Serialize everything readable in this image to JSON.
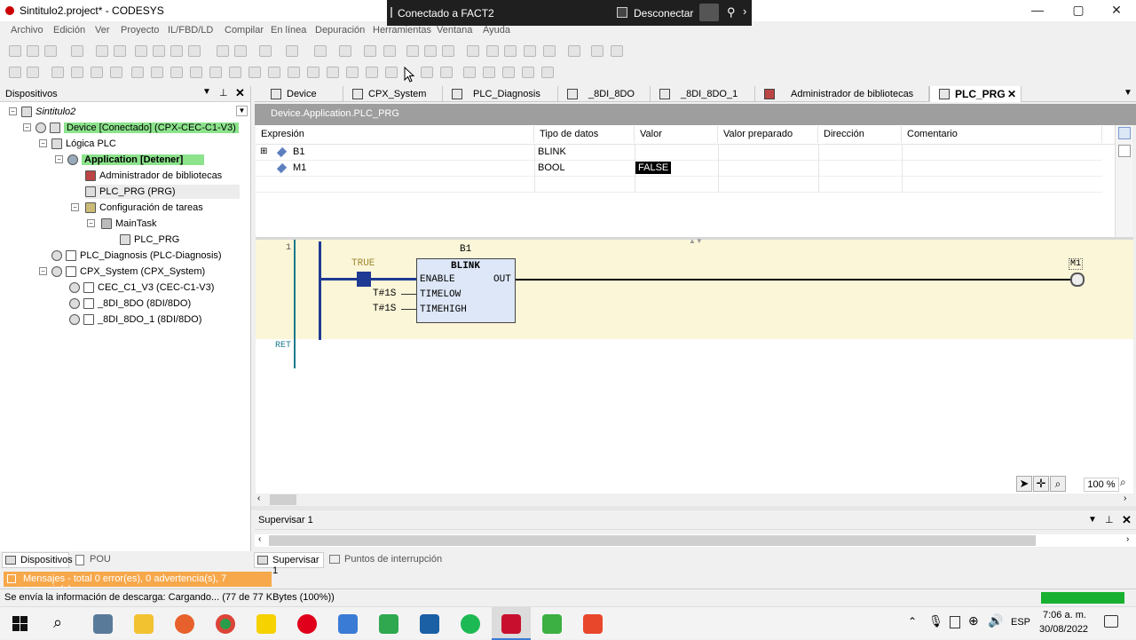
{
  "window": {
    "title": "Sintitulo2.project* - CODESYS",
    "min": "—",
    "max": "▢",
    "close": "✕"
  },
  "remote": {
    "connected_label": "Conectado a FACT2",
    "disconnect_label": "Desconectar",
    "pin": "⚲",
    "more": "›"
  },
  "menu": [
    "Archivo",
    "Edición",
    "Ver",
    "Proyecto",
    "IL/FBD/LD",
    "Compilar",
    "En línea",
    "Depuración",
    "Herramientas",
    "Ventana",
    "Ayuda"
  ],
  "devices_panel": {
    "title": "Dispositivos",
    "tree": [
      {
        "label": "Sintitulo2",
        "italic": true
      },
      {
        "label": "Device [Conectado] (CPX-CEC-C1-V3)",
        "highlight": true
      },
      {
        "label": "Lógica PLC"
      },
      {
        "label": "Application [Detener]",
        "highlight": true,
        "bold": true
      },
      {
        "label": "Administrador de bibliotecas"
      },
      {
        "label": "PLC_PRG (PRG)",
        "selected": true
      },
      {
        "label": "Configuración de tareas"
      },
      {
        "label": "MainTask"
      },
      {
        "label": "PLC_PRG"
      },
      {
        "label": "PLC_Diagnosis (PLC-Diagnosis)"
      },
      {
        "label": "CPX_System (CPX_System)"
      },
      {
        "label": "CEC_C1_V3 (CEC-C1-V3)"
      },
      {
        "label": "_8DI_8DO (8DI/8DO)"
      },
      {
        "label": "_8DI_8DO_1 (8DI/8DO)"
      }
    ]
  },
  "tabs": [
    "Device",
    "CPX_System",
    "PLC_Diagnosis",
    "_8DI_8DO",
    "_8DI_8DO_1",
    "Administrador de bibliotecas",
    "PLC_PRG"
  ],
  "path": "Device.Application.PLC_PRG",
  "watch_table": {
    "headers": [
      "Expresión",
      "Tipo de datos",
      "Valor",
      "Valor preparado",
      "Dirección",
      "Comentario"
    ],
    "rows": [
      {
        "expr": "B1",
        "type": "BLINK",
        "value": ""
      },
      {
        "expr": "M1",
        "type": "BOOL",
        "value": "FALSE"
      }
    ]
  },
  "ladder": {
    "rung_number": "1",
    "fb_instance": "B1",
    "fb_type": "BLINK",
    "contact_value": "TRUE",
    "inputs": [
      "ENABLE",
      "TIMELOW",
      "TIMEHIGH"
    ],
    "input_values": [
      "T#1S",
      "T#1S"
    ],
    "output": "OUT",
    "coil": "M1",
    "ret": "RET",
    "zoom": "100 %"
  },
  "watch_panel": {
    "title": "Supervisar 1"
  },
  "bottom_tabs": {
    "devices": "Dispositivos",
    "pou": "POU",
    "watch": "Supervisar 1",
    "breakpoints": "Puntos de interrupción"
  },
  "messages": "Mensajes - total 0 error(es), 0 advertencia(s), 7 mensaje(s)",
  "status": "Se envía la información de descarga: Cargando... (77 de 77 KBytes (100%))",
  "tray": {
    "lang": "ESP",
    "time": "7:06 a. m.",
    "date": "30/08/2022"
  },
  "colors": {
    "accent_green": "#8ce38c",
    "message_orange": "#f7a84b",
    "ladder_bg": "#fbf6d8",
    "rail_blue": "#1f3a93"
  }
}
